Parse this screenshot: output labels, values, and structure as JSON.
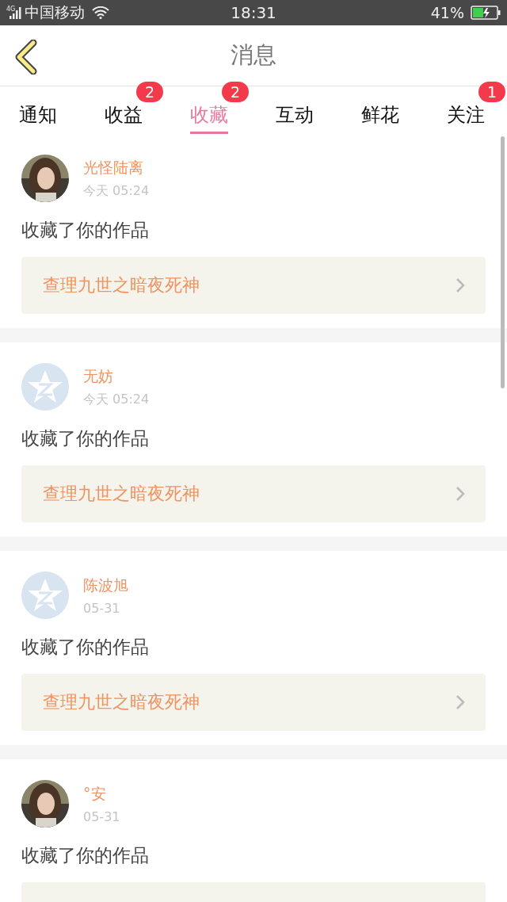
{
  "status_bar": {
    "network": "4G",
    "carrier": "中国移动",
    "time": "18:31",
    "battery": "41%"
  },
  "header": {
    "title": "消息"
  },
  "tabs": [
    {
      "label": "通知",
      "selected": false
    },
    {
      "label": "收益",
      "selected": false,
      "badge": "2"
    },
    {
      "label": "收藏",
      "selected": true,
      "badge": "2"
    },
    {
      "label": "互动",
      "selected": false
    },
    {
      "label": "鲜花",
      "selected": false
    },
    {
      "label": "关注",
      "selected": false,
      "badge": "1"
    }
  ],
  "messages": [
    {
      "name": "光怪陆离",
      "time": "今天 05:24",
      "kind": "picture",
      "action": "收藏了你的作品",
      "work": "查理九世之暗夜死神"
    },
    {
      "name": "无妨",
      "time": "今天 05:24",
      "kind": "default",
      "action": "收藏了你的作品",
      "work": "查理九世之暗夜死神"
    },
    {
      "name": "陈波旭",
      "time": "05-31",
      "kind": "default",
      "action": "收藏了你的作品",
      "work": "查理九世之暗夜死神"
    },
    {
      "name": "°安",
      "time": "05-31",
      "kind": "picture",
      "action": "收藏了你的作品"
    }
  ]
}
